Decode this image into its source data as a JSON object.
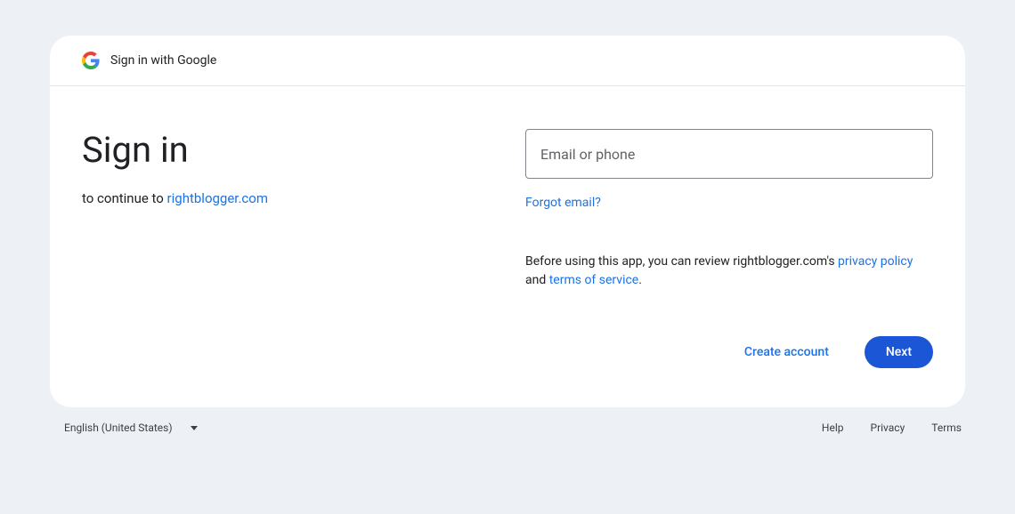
{
  "header": {
    "title": "Sign in with Google"
  },
  "main": {
    "heading": "Sign in",
    "continue_prefix": "to continue to ",
    "app_name": "rightblogger.com"
  },
  "form": {
    "email_placeholder": "Email or phone",
    "forgot_email": "Forgot email?",
    "review_before": "Before using this app, you can review rightblogger.com's ",
    "privacy_policy": "privacy policy",
    "review_and": " and ",
    "terms_of_service": "terms of service",
    "review_period": "."
  },
  "actions": {
    "create_account": "Create account",
    "next": "Next"
  },
  "footer": {
    "language": "English (United States)",
    "links": {
      "help": "Help",
      "privacy": "Privacy",
      "terms": "Terms"
    }
  }
}
